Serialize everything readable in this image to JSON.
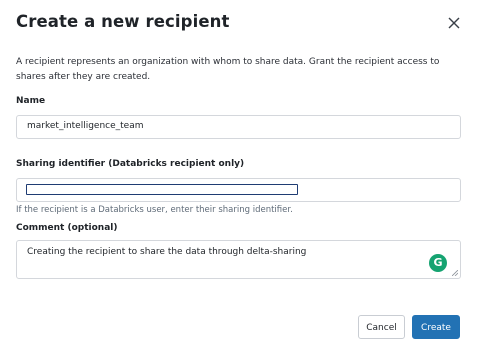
{
  "dialog": {
    "title": "Create a new recipient",
    "description": "A recipient represents an organization with whom to share data. Grant the recipient access to shares after they are created."
  },
  "name_field": {
    "label": "Name",
    "value": "market_intelligence_team"
  },
  "sharing_field": {
    "label": "Sharing identifier (Databricks recipient only)",
    "value": "",
    "hint": "If the recipient is a Databricks user, enter their sharing identifier."
  },
  "comment_field": {
    "label": "Comment (optional)",
    "value": "Creating the recipient to share the data through delta-sharing"
  },
  "grammarly": {
    "glyph": "G",
    "icon": "grammarly-icon",
    "color": "#15a371"
  },
  "buttons": {
    "cancel": "Cancel",
    "create": "Create"
  },
  "colors": {
    "primary": "#2272b4",
    "text": "#1f2328",
    "hint": "#5f6b78",
    "border": "#d4d7dc"
  }
}
